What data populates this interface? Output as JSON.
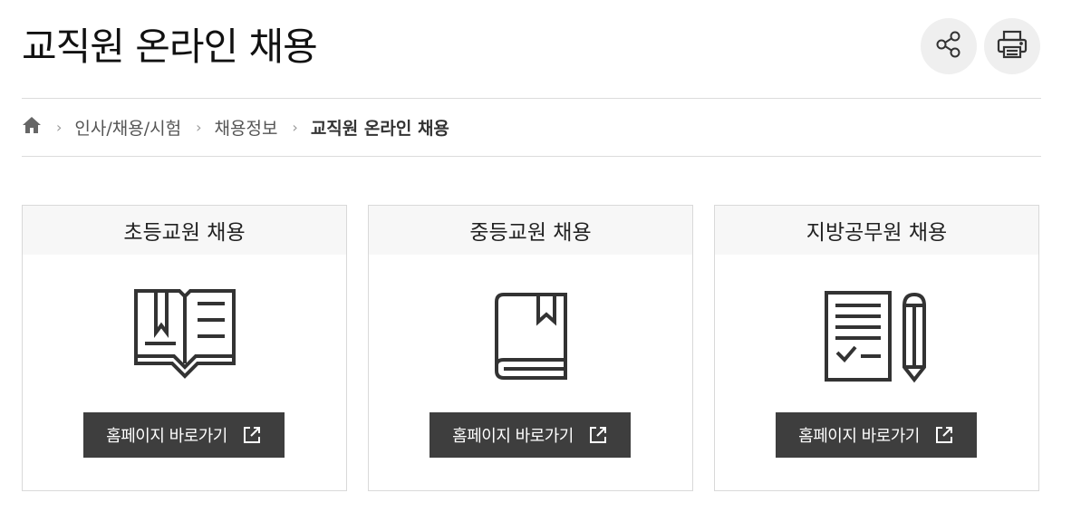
{
  "header": {
    "title": "교직원 온라인 채용",
    "share_icon": "share-icon",
    "print_icon": "print-icon"
  },
  "breadcrumb": {
    "home_icon": "home-icon",
    "items": [
      "인사/채용/시험",
      "채용정보",
      "교직원 온라인 채용"
    ]
  },
  "cards": [
    {
      "title": "초등교원 채용",
      "icon": "open-book-icon",
      "button_label": "홈페이지 바로가기",
      "button_icon": "external-link-icon"
    },
    {
      "title": "중등교원 채용",
      "icon": "closed-book-icon",
      "button_label": "홈페이지 바로가기",
      "button_icon": "external-link-icon"
    },
    {
      "title": "지방공무원 채용",
      "icon": "document-pencil-icon",
      "button_label": "홈페이지 바로가기",
      "button_icon": "external-link-icon"
    }
  ],
  "colors": {
    "button_bg": "#3e3e3e",
    "card_header_bg": "#f7f7f7",
    "tool_bg": "#efefef"
  }
}
